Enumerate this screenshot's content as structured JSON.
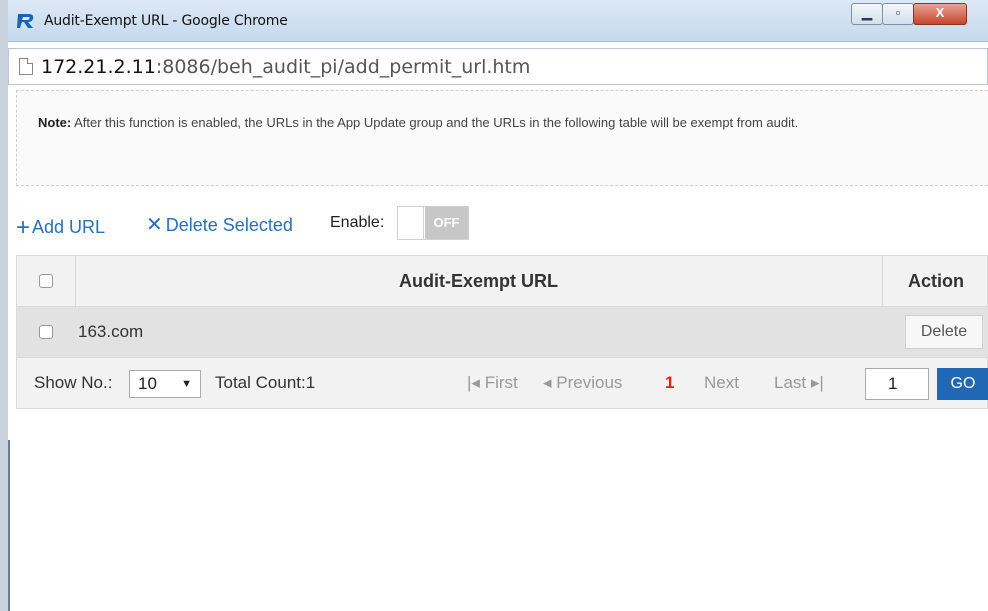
{
  "window": {
    "title": "Audit-Exempt URL - Google Chrome",
    "icons": {
      "app": "ruijie-r-icon",
      "minimize": "minimize-icon",
      "maximize": "maximize-icon",
      "close": "close-icon"
    },
    "close_glyph": "X"
  },
  "address_bar": {
    "host": "172.21.2.11",
    "rest": ":8086/beh_audit_pi/add_permit_url.htm"
  },
  "note": {
    "label": "Note:",
    "text": " After this function is enabled, the URLs in the App Update group and the URLs in the following table will be exempt from audit."
  },
  "toolbar": {
    "add_icon": "+",
    "add_label": "Add URL",
    "delete_icon": "✕",
    "delete_label": "Delete Selected",
    "enable_label": "Enable:",
    "toggle_state": "OFF"
  },
  "table": {
    "columns": [
      "Audit-Exempt URL",
      "Action"
    ],
    "rows": [
      {
        "url": "163.com",
        "action": "Delete"
      }
    ]
  },
  "pager": {
    "show_label": "Show No.:",
    "page_size": "10",
    "total_label": "Total Count:1",
    "first": "First",
    "previous": "Previous",
    "current_page": "1",
    "next": "Next",
    "last": "Last",
    "page_input": "1",
    "go": "GO"
  },
  "colors": {
    "accent": "#2a6fb7",
    "go_button": "#2068b4",
    "current_page": "#d9261c",
    "toggle_off": "#c7c7c7"
  }
}
